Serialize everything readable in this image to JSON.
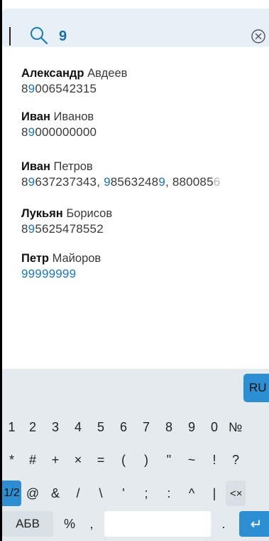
{
  "search": {
    "query": "9"
  },
  "contacts": [
    {
      "first": "Александр",
      "last": "Авдеев",
      "phone_parts": [
        {
          "t": "8",
          "h": false
        },
        {
          "t": "9",
          "h": true
        },
        {
          "t": "006542315",
          "h": false
        }
      ]
    },
    {
      "first": "Иван",
      "last": "Иванов",
      "phone_parts": [
        {
          "t": "8",
          "h": false
        },
        {
          "t": "9",
          "h": true
        },
        {
          "t": "000000000",
          "h": false
        }
      ]
    },
    {
      "first": "Иван",
      "last": "Петров",
      "phone_parts": [
        {
          "t": "8",
          "h": false
        },
        {
          "t": "9",
          "h": true
        },
        {
          "t": "637237343, ",
          "h": false
        },
        {
          "t": "9",
          "h": true
        },
        {
          "t": "8563248",
          "h": false
        },
        {
          "t": "9",
          "h": true
        },
        {
          "t": ", 880085",
          "h": false
        },
        {
          "t": "6",
          "f": true
        }
      ]
    },
    {
      "first": "Лукьян",
      "last": "Борисов",
      "phone_parts": [
        {
          "t": "8",
          "h": false
        },
        {
          "t": "9",
          "h": true
        },
        {
          "t": "5625478552",
          "h": false
        }
      ]
    },
    {
      "first": "Петр",
      "last": "Майоров",
      "phone_parts": [
        {
          "t": "99999999",
          "h": true
        }
      ]
    }
  ],
  "keyboard": {
    "lang": "RU",
    "row1": [
      "1",
      "2",
      "3",
      "4",
      "5",
      "6",
      "7",
      "8",
      "9",
      "0",
      "№"
    ],
    "row2": [
      "*",
      "#",
      "+",
      "×",
      "=",
      "(",
      ")",
      "\"",
      "~",
      "!",
      "?"
    ],
    "row3": [
      "1/2",
      "@",
      "&",
      "/",
      "\\",
      "'",
      ";",
      ":",
      "^",
      "|",
      "<×"
    ],
    "row4": {
      "abc": "АБВ",
      "percent": "%",
      "comma": ",",
      "dot": ".",
      "enter": "↵"
    }
  },
  "colors": {
    "accent": "#2d8fd1",
    "highlight": "#1a78b8",
    "search_bg": "#e8f0f7",
    "keyboard_bg": "#e5eaee"
  }
}
